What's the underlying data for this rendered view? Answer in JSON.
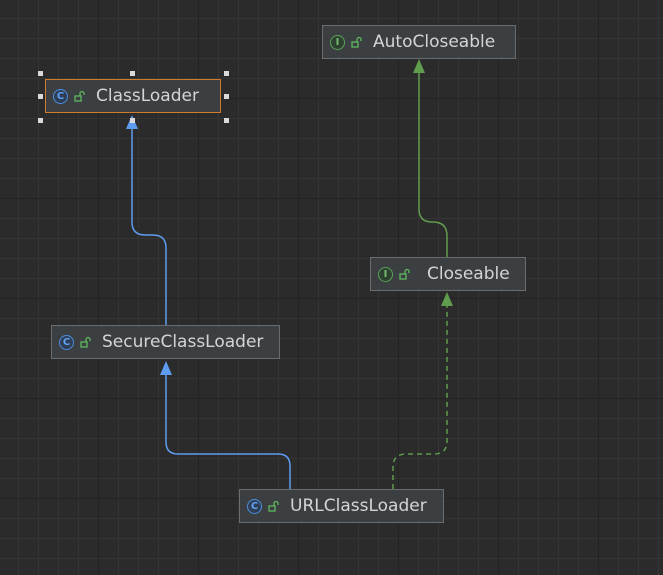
{
  "diagram": {
    "nodes": [
      {
        "id": "ClassLoader",
        "label": "ClassLoader",
        "kind": "class",
        "kind_glyph": "C",
        "selected": true
      },
      {
        "id": "AutoCloseable",
        "label": "AutoCloseable",
        "kind": "interface",
        "kind_glyph": "I",
        "selected": false
      },
      {
        "id": "Closeable",
        "label": "Closeable",
        "kind": "interface",
        "kind_glyph": "I",
        "selected": false
      },
      {
        "id": "SecureClassLoader",
        "label": "SecureClassLoader",
        "kind": "class",
        "kind_glyph": "C",
        "selected": false
      },
      {
        "id": "URLClassLoader",
        "label": "URLClassLoader",
        "kind": "class",
        "kind_glyph": "C",
        "selected": false
      }
    ],
    "edges": [
      {
        "from": "SecureClassLoader",
        "to": "ClassLoader",
        "type": "extends"
      },
      {
        "from": "URLClassLoader",
        "to": "SecureClassLoader",
        "type": "extends"
      },
      {
        "from": "Closeable",
        "to": "AutoCloseable",
        "type": "extends-interface"
      },
      {
        "from": "URLClassLoader",
        "to": "Closeable",
        "type": "implements"
      }
    ],
    "colors": {
      "extends": "#5e9cf0",
      "extends_interface": "#5f9c4d",
      "implements": "#5f9c4d",
      "selected_border": "#d07b2e",
      "node_background": "#3c3f41"
    },
    "icons": {
      "class": "class-c-icon",
      "interface": "interface-i-icon",
      "visibility": "unlocked-public-icon"
    }
  }
}
